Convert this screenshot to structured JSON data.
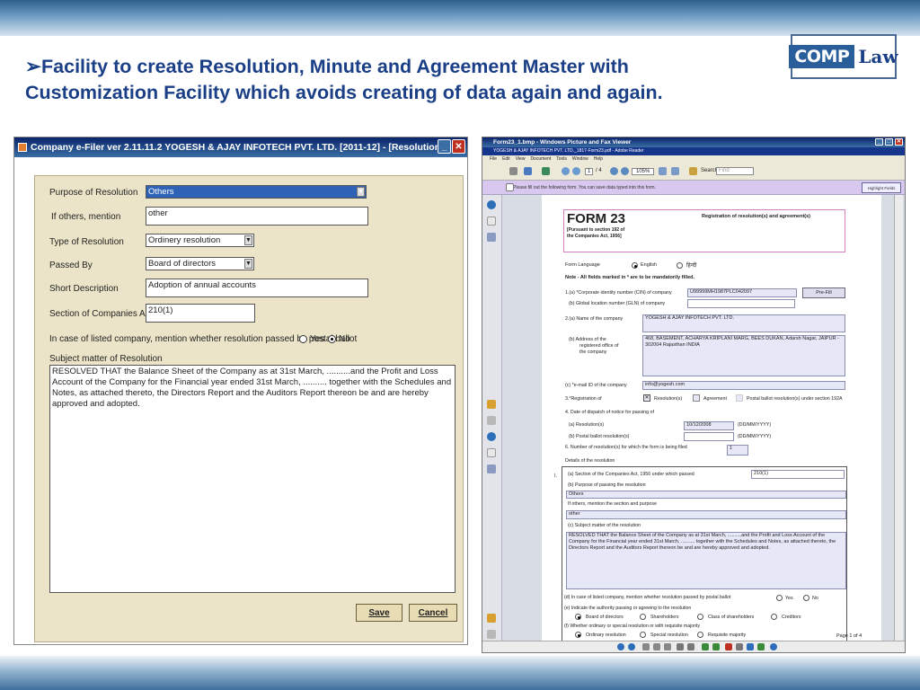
{
  "headline": {
    "arrow": "➢",
    "text": "Facility to create Resolution, Minute and Agreement Master with Customization Facility which avoids creating of data again and again."
  },
  "logo": {
    "comp": "COMP",
    "law": "Law"
  },
  "left_window": {
    "title": "Company e-Filer ver 2.11.11.2 YOGESH & AJAY INFOTECH PVT. LTD. [2011-12] - [Resolution]",
    "fields": {
      "purpose_label": "Purpose of Resolution",
      "purpose_value": "Others",
      "if_others_label": "If others, mention",
      "if_others_value": "other",
      "type_label": "Type of Resolution",
      "type_value": "Ordinery resolution",
      "passed_by_label": "Passed By",
      "passed_by_value": "Board of directors",
      "short_desc_label": "Short Description",
      "short_desc_value": "Adoption of annual accounts",
      "section_label": "Section of Companies Act",
      "section_value": "210(1)",
      "postal_label": "In case of listed company, mention whether resolution passed by postal ballot",
      "yes_label": "Yes",
      "no_label": "No",
      "subject_label": "Subject matter of Resolution",
      "subject_value": "RESOLVED THAT the Balance Sheet of the Company as at 31st March, ..........and the Profit and Loss Account of the Company for the Financial year ended 31st March, .......... together with the Schedules and Notes, as attached thereto, the Directors Report and the Auditors Report thereon be and are hereby approved and adopted."
    },
    "buttons": {
      "save": "Save",
      "cancel": "Cancel"
    }
  },
  "right_window": {
    "title": "Form23_1.bmp - Windows Picture and Fax Viewer",
    "subtitle": "YOGESH & AJAY INFOTECH PVT. LTD._1817-Form23.pdf - Adobe Reader",
    "menu": [
      "File",
      "Edit",
      "View",
      "Document",
      "Tools",
      "Window",
      "Help"
    ],
    "toolbar": {
      "page": "1",
      "of": "/ 4",
      "zoom": "105%",
      "search_label": "Search",
      "find_placeholder": "Find"
    },
    "infobar": "Please fill out the following form. You can save data typed into this form.",
    "highlight_button": "Highlight Fields",
    "form": {
      "title": "FORM 23",
      "sub1": "[Pursuant to section 192 of",
      "sub2": "the Companies Act, 1956]",
      "reg_title": "Registration of resolution(s) and agreement(s)",
      "form_language": "Form Language",
      "english": "English",
      "hindi": "हिन्दी",
      "note": "Note - All fields marked in * are to be mandatorily filled.",
      "cin_label": "1.(a) *Corporate identity number (CIN) of company",
      "cin_value": "U99999MH1987PLC042097",
      "prefill": "Pre-Fill",
      "gln_label": "(b) Global location number (GLN) of company",
      "name_label": "2.(a) Name of the company",
      "name_value": "YOGESH & AJAY INFOTECH PVT. LTD.",
      "address_label1": "(b) Address of the",
      "address_label2": "registered office of",
      "address_label3": "the company",
      "address_value": "468, BASEMENT, ACHARYA KRIPLANI MARG, BEES DUKAN, Adarsh Nagar, JAIPUR - 302004 Rajasthan INDIA",
      "email_label": "(c) *e-mail ID of the company",
      "email_value": "info@yogesh.com",
      "reg_of": "3.*Registration of",
      "reg_res": "Resolution(s)",
      "reg_agr": "Agreement",
      "reg_postal": "Postal ballot resolution(s) under section 192A",
      "dispatch_label": "4. Date of dispatch of notice for passing of",
      "dispatch_res": "(a) Resolution(s)",
      "dispatch_res_value": "10/12/2008",
      "dispatch_postal": "(b) Postal ballot resolution(s)",
      "date_fmt1": "(DD/MM/YYYY)",
      "date_fmt2": "(DD/MM/YYYY)",
      "num_label": "6. Number of resolution(s) for which the form is being filed",
      "num_value": "1",
      "details": "Details of the resolution",
      "roman": "I.",
      "sec_label": "(a) Section of the Companies Act, 1956 under which passed",
      "sec_value": "210(1)",
      "purpose_label": "(b) Purpose of passing the resolution",
      "purpose_value": "Others",
      "if_others": "If others, mention the section and purpose",
      "if_others_value": "other",
      "subject_label": "(c) Subject matter of the resolution",
      "subject_value": "RESOLVED THAT the Balance Sheet of the Company as at 31st March, ..........and the Profit and Loss Account of the Company for the Financial year ended 31st March, .......... together with the Schedules and Notes, as attached thereto, the Directors Report and the Auditors Report thereon be and are hereby approved and adopted.",
      "listed_label": "(d) In case of listed company, mention whether resolution passed by postal ballot",
      "yes": "Yes",
      "no": "No",
      "authority_label": "(e) Indicate the authority passing or agreeing to the resolution",
      "board": "Board of directors",
      "shareholders": "Shareholders",
      "class_share": "Class of shareholders",
      "creditors": "Creditors",
      "ordinary_label": "(f) Whether ordinary or special resolution or with requisite majority",
      "ordinary": "Ordinary resolution",
      "special": "Special resolution",
      "requisite": "Requisite majority",
      "page_of": "Page 1 of 4"
    }
  }
}
